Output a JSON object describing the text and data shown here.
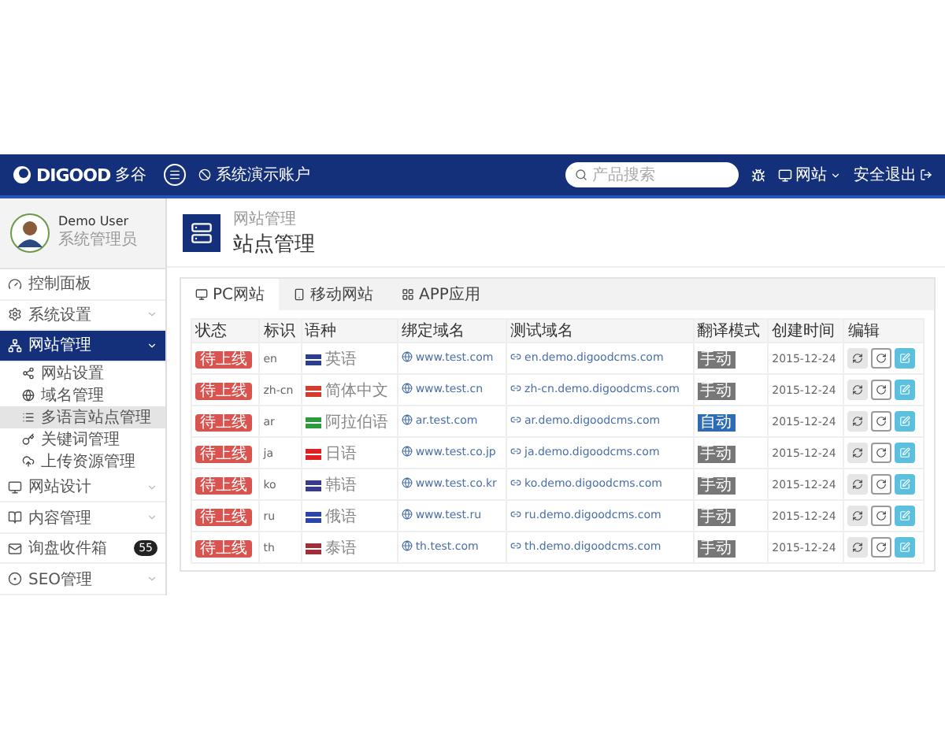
{
  "topbar": {
    "logo_text": "DIGOOD",
    "logo_sub": "多谷",
    "account": "系统演示账户",
    "search": {
      "placeholder": "产品搜索"
    },
    "site_menu": "网站",
    "logout": "安全退出"
  },
  "user": {
    "name": "Demo User",
    "role": "系统管理员"
  },
  "sidebar": {
    "items": [
      {
        "label": "控制面板",
        "kind": "link",
        "selected": false
      },
      {
        "label": "系统设置",
        "kind": "group",
        "selected": false
      },
      {
        "label": "网站管理",
        "kind": "group",
        "selected": true,
        "children": [
          {
            "label": "网站设置",
            "selected": false
          },
          {
            "label": "域名管理",
            "selected": false
          },
          {
            "label": "多语言站点管理",
            "selected": true
          },
          {
            "label": "关键词管理",
            "selected": false
          },
          {
            "label": "上传资源管理",
            "selected": false
          }
        ]
      },
      {
        "label": "网站设计",
        "kind": "group",
        "selected": false
      },
      {
        "label": "内容管理",
        "kind": "group",
        "selected": false
      },
      {
        "label": "询盘收件箱",
        "kind": "counter",
        "selected": false,
        "badge": "55"
      },
      {
        "label": "SEO管理",
        "kind": "group",
        "selected": false
      }
    ]
  },
  "page": {
    "breadcrumb": "网站管理",
    "title": "站点管理"
  },
  "tabs": [
    {
      "label": "PC网站",
      "selected": true
    },
    {
      "label": "移动网站",
      "selected": false
    },
    {
      "label": "APP应用",
      "selected": false
    }
  ],
  "table": {
    "columns": [
      "状态",
      "标识",
      "语种",
      "绑定域名",
      "测试域名",
      "翻译模式",
      "创建时间",
      "编辑"
    ],
    "rows": [
      {
        "status": "待上线",
        "code": "en",
        "language": "英语",
        "domain": "www.test.com",
        "test_domain": "en.demo.digoodcms.com",
        "mode": "手动",
        "auto": false,
        "created": "2015-12-24"
      },
      {
        "status": "待上线",
        "code": "zh-cn",
        "language": "简体中文",
        "domain": "www.test.cn",
        "test_domain": "zh-cn.demo.digoodcms.com",
        "mode": "手动",
        "auto": false,
        "created": "2015-12-24"
      },
      {
        "status": "待上线",
        "code": "ar",
        "language": "阿拉伯语",
        "domain": "ar.test.com",
        "test_domain": "ar.demo.digoodcms.com",
        "mode": "自动",
        "auto": true,
        "created": "2015-12-24"
      },
      {
        "status": "待上线",
        "code": "ja",
        "language": "日语",
        "domain": "www.test.co.jp",
        "test_domain": "ja.demo.digoodcms.com",
        "mode": "手动",
        "auto": false,
        "created": "2015-12-24"
      },
      {
        "status": "待上线",
        "code": "ko",
        "language": "韩语",
        "domain": "www.test.co.kr",
        "test_domain": "ko.demo.digoodcms.com",
        "mode": "手动",
        "auto": false,
        "created": "2015-12-24"
      },
      {
        "status": "待上线",
        "code": "ru",
        "language": "俄语",
        "domain": "www.test.ru",
        "test_domain": "ru.demo.digoodcms.com",
        "mode": "手动",
        "auto": false,
        "created": "2015-12-24"
      },
      {
        "status": "待上线",
        "code": "th",
        "language": "泰语",
        "domain": "th.test.com",
        "test_domain": "th.demo.digoodcms.com",
        "mode": "手动",
        "auto": false,
        "created": "2015-12-24"
      }
    ]
  }
}
